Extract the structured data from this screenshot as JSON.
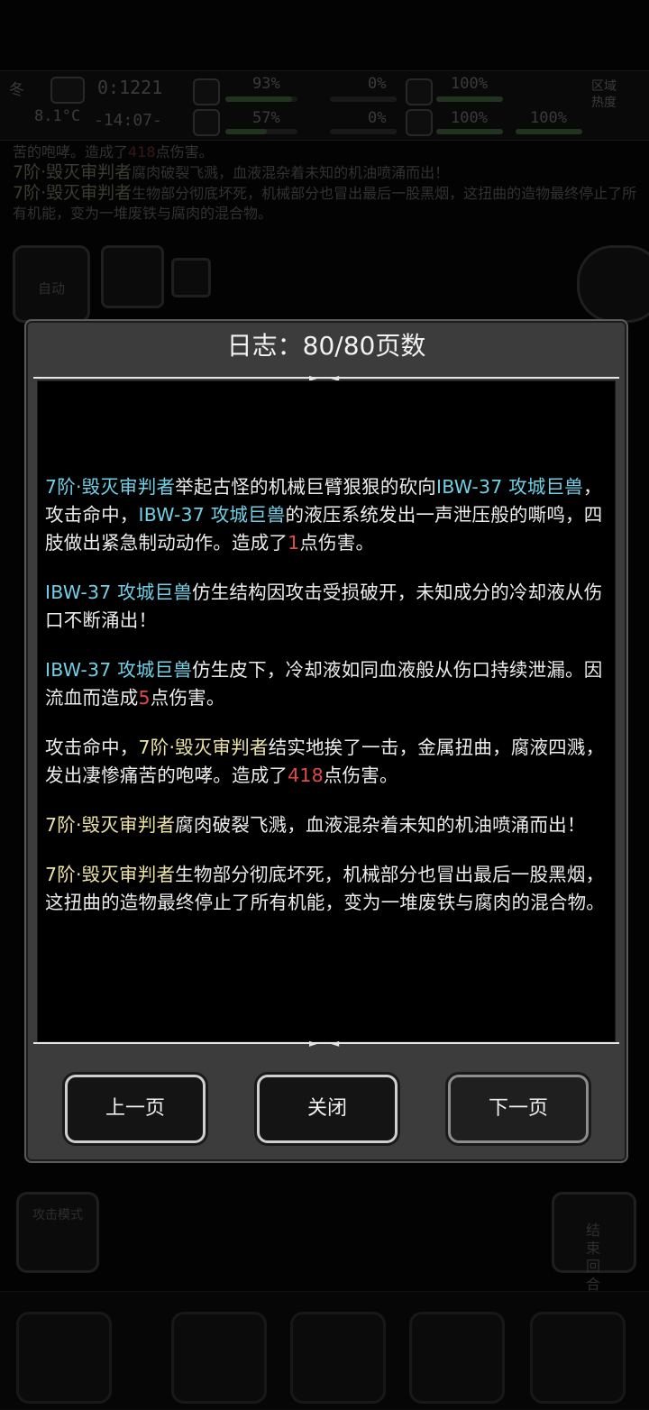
{
  "status": {
    "season": "冬",
    "temperature": "8.1°C",
    "clock_top": "0:1221",
    "clock_bottom": "-14:07-",
    "vitals": [
      "93%",
      "57%",
      "0%",
      "0%",
      "100%",
      "100%",
      "100%"
    ],
    "zone_heat_label": "区域热度"
  },
  "background_log": {
    "line0": {
      "prefix": "苦的咆哮。造成了",
      "value": "418",
      "suffix": "点伤害。"
    },
    "line1": {
      "actor": "7阶·毁灭审判者",
      "text": "腐肉破裂飞溅，血液混杂着未知的机油喷涌而出！"
    },
    "line2": {
      "actor": "7阶·毁灭审判者",
      "text": "生物部分彻底坏死，机械部分也冒出最后一股黑烟，这扭曲的造物最终停止了所有机能，变为一堆废铁与腐肉的混合物。"
    }
  },
  "background_buttons": {
    "auto": "自动",
    "attack_mode": "攻击模式",
    "end_turn": "结束回合"
  },
  "dialog": {
    "title": "日志：80/80页数",
    "entries": [
      {
        "parts": [
          {
            "t": "7阶·毁灭审判者",
            "c": "cyan"
          },
          {
            "t": "举起古怪的机械巨臂狠狠的砍向",
            "c": ""
          },
          {
            "t": "IBW-37 攻城巨兽",
            "c": "cyan"
          },
          {
            "t": "，攻击命中，",
            "c": ""
          },
          {
            "t": "IBW-37 攻城巨兽",
            "c": "cyan"
          },
          {
            "t": "的液压系统发出一声泄压般的嘶鸣，四肢做出紧急制动动作。造成了",
            "c": ""
          },
          {
            "t": "1",
            "c": "red"
          },
          {
            "t": "点伤害。",
            "c": ""
          }
        ]
      },
      {
        "parts": [
          {
            "t": "IBW-37 攻城巨兽",
            "c": "cyan"
          },
          {
            "t": "仿生结构因攻击受损破开，未知成分的冷却液从伤口不断涌出！",
            "c": ""
          }
        ]
      },
      {
        "parts": [
          {
            "t": "IBW-37 攻城巨兽",
            "c": "cyan"
          },
          {
            "t": "仿生皮下，冷却液如同血液般从伤口持续泄漏。因流血而造成",
            "c": ""
          },
          {
            "t": "5",
            "c": "red"
          },
          {
            "t": "点伤害。",
            "c": ""
          }
        ]
      },
      {
        "parts": [
          {
            "t": "攻击命中，",
            "c": ""
          },
          {
            "t": "7阶·毁灭审判者",
            "c": "yellow"
          },
          {
            "t": "结实地挨了一击，金属扭曲，腐液四溅，发出凄惨痛苦的咆哮。造成了",
            "c": ""
          },
          {
            "t": "418",
            "c": "red"
          },
          {
            "t": "点伤害。",
            "c": ""
          }
        ]
      },
      {
        "parts": [
          {
            "t": "7阶·毁灭审判者",
            "c": "yellow"
          },
          {
            "t": "腐肉破裂飞溅，血液混杂着未知的机油喷涌而出！",
            "c": ""
          }
        ]
      },
      {
        "parts": [
          {
            "t": "7阶·毁灭审判者",
            "c": "yellow"
          },
          {
            "t": "生物部分彻底坏死，机械部分也冒出最后一股黑烟，这扭曲的造物最终停止了所有机能，变为一堆废铁与腐肉的混合物。",
            "c": ""
          }
        ]
      }
    ],
    "buttons": {
      "prev": "上一页",
      "close": "关闭",
      "next": "下一页"
    }
  },
  "colors": {
    "actor_enemy": "#6fd0e6",
    "actor_self": "#ece3a3",
    "damage": "#e04a4a"
  }
}
